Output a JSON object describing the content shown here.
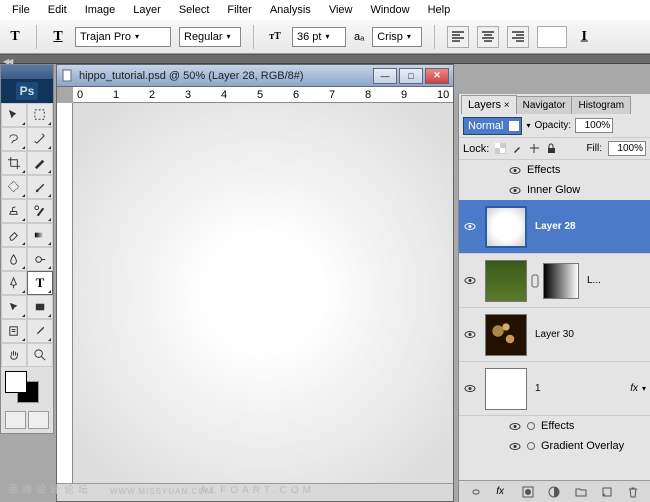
{
  "menu": {
    "items": [
      "File",
      "Edit",
      "Image",
      "Layer",
      "Select",
      "Filter",
      "Analysis",
      "View",
      "Window",
      "Help"
    ]
  },
  "options": {
    "font_family": "Trajan Pro",
    "font_style": "Regular",
    "font_size": "36 pt",
    "aa_label": "Crisp",
    "aa_prefix": "aₐ"
  },
  "doc": {
    "title": "hippo_tutorial.psd @ 50% (Layer 28, RGB/8#)",
    "ruler_marks": [
      "0",
      "1",
      "2",
      "3",
      "4",
      "5",
      "6",
      "7",
      "8",
      "9",
      "10"
    ]
  },
  "watermark": {
    "left": "思缘设计论坛",
    "right": "ALFOART.COM",
    "mid": "WWW.MISSYUAN.COM"
  },
  "panel": {
    "tabs": [
      "Layers",
      "Navigator",
      "Histogram"
    ],
    "blend_mode": "Normal",
    "opacity_label": "Opacity:",
    "opacity_value": "100%",
    "lock_label": "Lock:",
    "fill_label": "Fill:",
    "fill_value": "100%",
    "effects_label": "Effects",
    "inner_glow": "Inner Glow",
    "gradient_overlay": "Gradient Overlay",
    "layers": [
      {
        "name": "Layer 28",
        "selected": true
      },
      {
        "name": "L..."
      },
      {
        "name": "Layer 30"
      },
      {
        "name": "1"
      }
    ],
    "fx_label": "fx"
  }
}
